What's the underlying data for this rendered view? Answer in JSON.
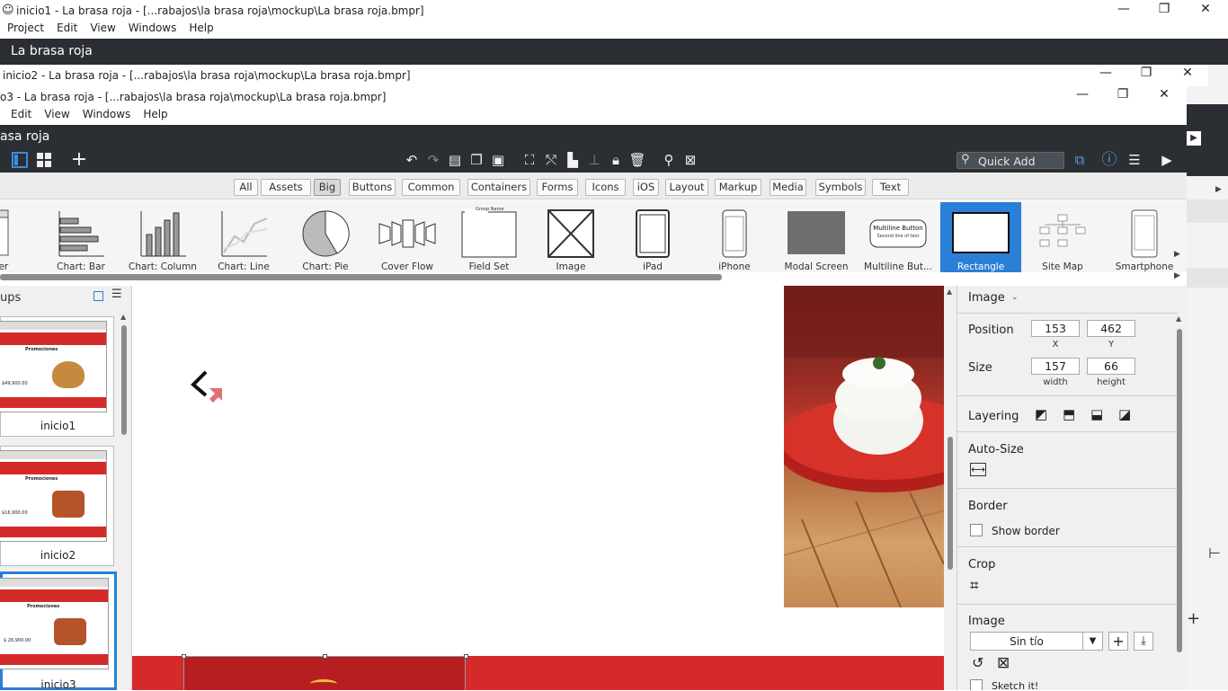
{
  "win1": {
    "title": "inicio1 - La brasa roja - [...rabajos\\la brasa roja\\mockup\\La brasa roja.bmpr]",
    "menu": [
      "Project",
      "Edit",
      "View",
      "Windows",
      "Help"
    ],
    "app_title": "La brasa roja"
  },
  "win2": {
    "title": "inicio2 - La brasa roja - [...rabajos\\la brasa roja\\mockup\\La brasa roja.bmpr]"
  },
  "win3": {
    "title": "o3 - La brasa roja - [...rabajos\\la brasa roja\\mockup\\La brasa roja.bmpr]",
    "menu": [
      "Edit",
      "View",
      "Windows",
      "Help"
    ],
    "app_title": "asa roja"
  },
  "window_controls": {
    "minimize": "—",
    "restore": "❐",
    "close": "✕"
  },
  "toolbar": {
    "quick_add_placeholder": "Quick Add"
  },
  "filters": [
    "All",
    "Assets",
    "Big",
    "Buttons",
    "Common",
    "Containers",
    "Forms",
    "Icons",
    "iOS",
    "Layout",
    "Markup",
    "Media",
    "Symbols",
    "Text"
  ],
  "active_filter": "Big",
  "components": [
    {
      "label": "vser",
      "icon": "browser-icon"
    },
    {
      "label": "Chart: Bar",
      "icon": "bar-chart-icon"
    },
    {
      "label": "Chart: Column",
      "icon": "column-chart-icon"
    },
    {
      "label": "Chart: Line",
      "icon": "line-chart-icon"
    },
    {
      "label": "Chart: Pie",
      "icon": "pie-chart-icon"
    },
    {
      "label": "Cover Flow",
      "icon": "cover-flow-icon"
    },
    {
      "label": "Field Set",
      "icon": "field-set-icon"
    },
    {
      "label": "Image",
      "icon": "image-placeholder-icon"
    },
    {
      "label": "iPad",
      "icon": "ipad-icon"
    },
    {
      "label": "iPhone",
      "icon": "iphone-icon"
    },
    {
      "label": "Modal Screen",
      "icon": "modal-screen-icon"
    },
    {
      "label": "Multiline But...",
      "icon": "multiline-button-icon"
    },
    {
      "label": "Rectangle",
      "icon": "rectangle-icon"
    },
    {
      "label": "Site Map",
      "icon": "site-map-icon"
    },
    {
      "label": "Smartphone",
      "icon": "smartphone-icon"
    }
  ],
  "field_set_caption": "Group Name",
  "multiline_button": {
    "line1": "Multiline Button",
    "line2": "Second line of text"
  },
  "mockups_panel": {
    "title": "ups",
    "items": [
      {
        "name": "inicio1",
        "heading": "Promociones",
        "price": "$49,900.00"
      },
      {
        "name": "inicio2",
        "heading": "Promociones",
        "price": "$16,900.00"
      },
      {
        "name": "inicio3",
        "heading": "Promociones",
        "price": "$ 26,900.00"
      }
    ]
  },
  "inspector": {
    "header": "Image",
    "position_label": "Position",
    "x": "153",
    "y": "462",
    "x_label": "X",
    "y_label": "Y",
    "size_label": "Size",
    "width": "157",
    "height": "66",
    "width_label": "width",
    "height_label": "height",
    "layering_label": "Layering",
    "autosize_label": "Auto-Size",
    "border_label": "Border",
    "show_border_label": "Show border",
    "crop_label": "Crop",
    "image_label": "Image",
    "image_value": "Sin tío",
    "sketch_label": "Sketch it!"
  },
  "colors": {
    "dark_bar": "#2b2f33",
    "selected": "#2a7fd6",
    "brand_red": "#d42a2a"
  }
}
